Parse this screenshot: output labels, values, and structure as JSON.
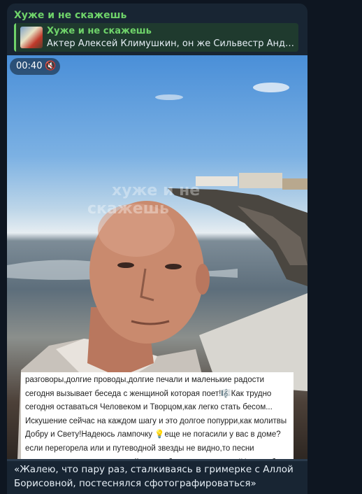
{
  "message": {
    "sender": "Хуже и не скажешь",
    "reply": {
      "title": "Хуже и не скажешь",
      "text": "Актер Алексей Климушкин, он же Сильвестр Андреев..."
    },
    "video": {
      "time": "00:40",
      "muted_icon": "speaker-muted-icon",
      "watermark": "хуже и не скажешь",
      "progress": 0.0,
      "subtitles": "разговоры,долгие проводы,долгие печали и маленькие радости сегодня вызывает беседа с женщиной которая поет!🎼Как трудно сегодня оставаться Человеком и Творцом,как легко стать бесом... Искушение сейчас на каждом шагу и это долгое попурри,как молитвы Добру и Свету!Надеюсь лампочку 💡еще не погасили у вас в доме?если перегорела или и путеводной звезды не видно,то песни вспомните и в душе мурлыкайте хотя бы-это разрешено !Ну хоть бы про себя и можно даже слегка давать петуха 🐓 Главное не"
    },
    "caption": "«Жалею, что пару раз, сталкиваясь в гримерке с Аллой Борисовной, постеснялся сфотографироваться»"
  },
  "colors": {
    "background": "#0e1621",
    "bubble": "#182533",
    "accent_green": "#6fd36a"
  }
}
